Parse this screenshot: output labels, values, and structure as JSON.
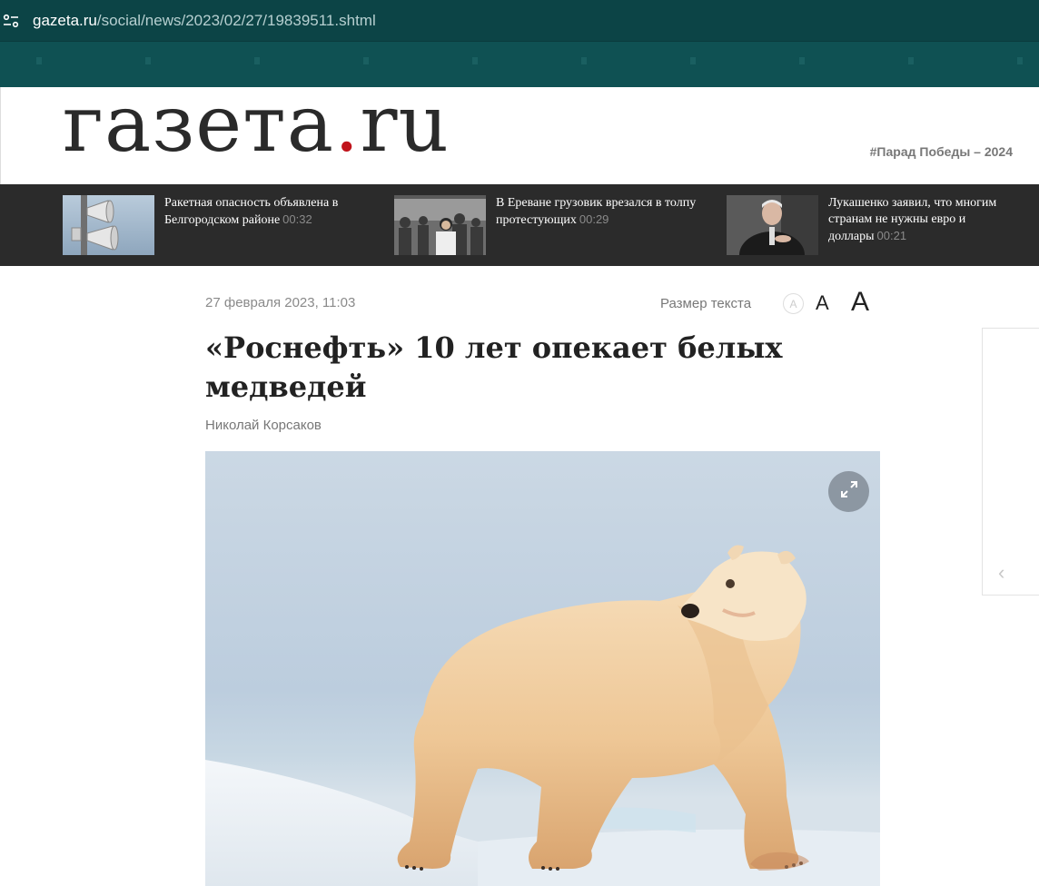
{
  "browser": {
    "url_host": "gazeta.ru",
    "url_path": "/social/news/2023/02/27/19839511.shtml",
    "site_info_icon": "tune-icon"
  },
  "header": {
    "logo_main": "газета",
    "logo_dot": ".",
    "logo_tld": "ru",
    "tag": "#Парад Победы – 2024"
  },
  "news_strip": {
    "items": [
      {
        "title": "Ракетная опасность объявлена в Белгородском районе",
        "time": "00:32",
        "thumb": "sirens-photo"
      },
      {
        "title": "В Ереване грузовик врезался в толпу протестующих",
        "time": "00:29",
        "thumb": "crowd-photo"
      },
      {
        "title": "Лукашенко заявил, что многим странам не нужны евро и доллары",
        "time": "00:21",
        "thumb": "speaker-photo"
      }
    ]
  },
  "article": {
    "date": "27 февраля 2023, 11:03",
    "text_size_label": "Размер текста",
    "size_small": "A",
    "size_mid": "A",
    "size_large": "A",
    "title": "«Роснефть» 10 лет опекает белых медведей",
    "author": "Николай Корсаков",
    "photo_subject": "polar-bear-photo"
  },
  "colors": {
    "browser_bg": "#0f4f51",
    "news_strip_bg": "#2b2b2b",
    "logo_dot": "#c0131b"
  }
}
